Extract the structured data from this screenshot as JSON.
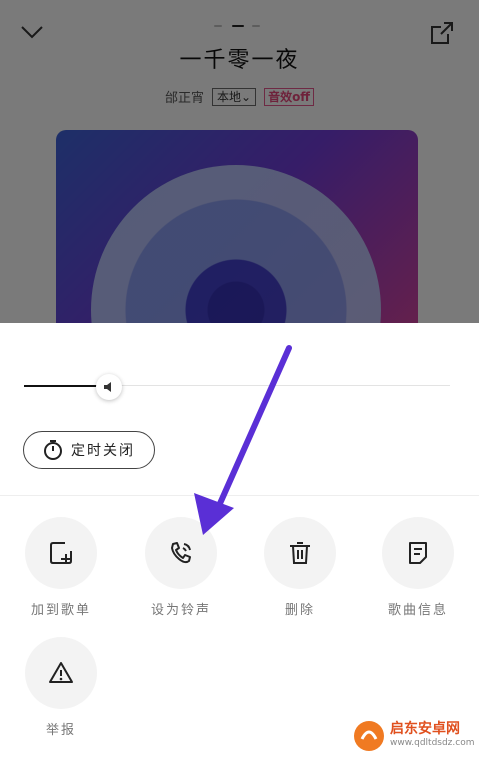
{
  "player": {
    "song_title": "一千零一夜",
    "artist": "邰正宵",
    "source_tag": "本地",
    "effect_tag": "音效off"
  },
  "sheet": {
    "volume_level": 0.2,
    "timer_label": "定时关闭",
    "actions": [
      {
        "label": "加到歌单",
        "icon": "add-playlist-icon"
      },
      {
        "label": "设为铃声",
        "icon": "phone-ring-icon"
      },
      {
        "label": "删除",
        "icon": "trash-icon"
      },
      {
        "label": "歌曲信息",
        "icon": "info-doc-icon"
      },
      {
        "label": "举报",
        "icon": "warning-icon"
      }
    ]
  },
  "annotation": {
    "arrow_color": "#5a2fd6"
  },
  "watermark": {
    "name": "启东安卓网",
    "url": "www.qdltdsdz.com"
  }
}
